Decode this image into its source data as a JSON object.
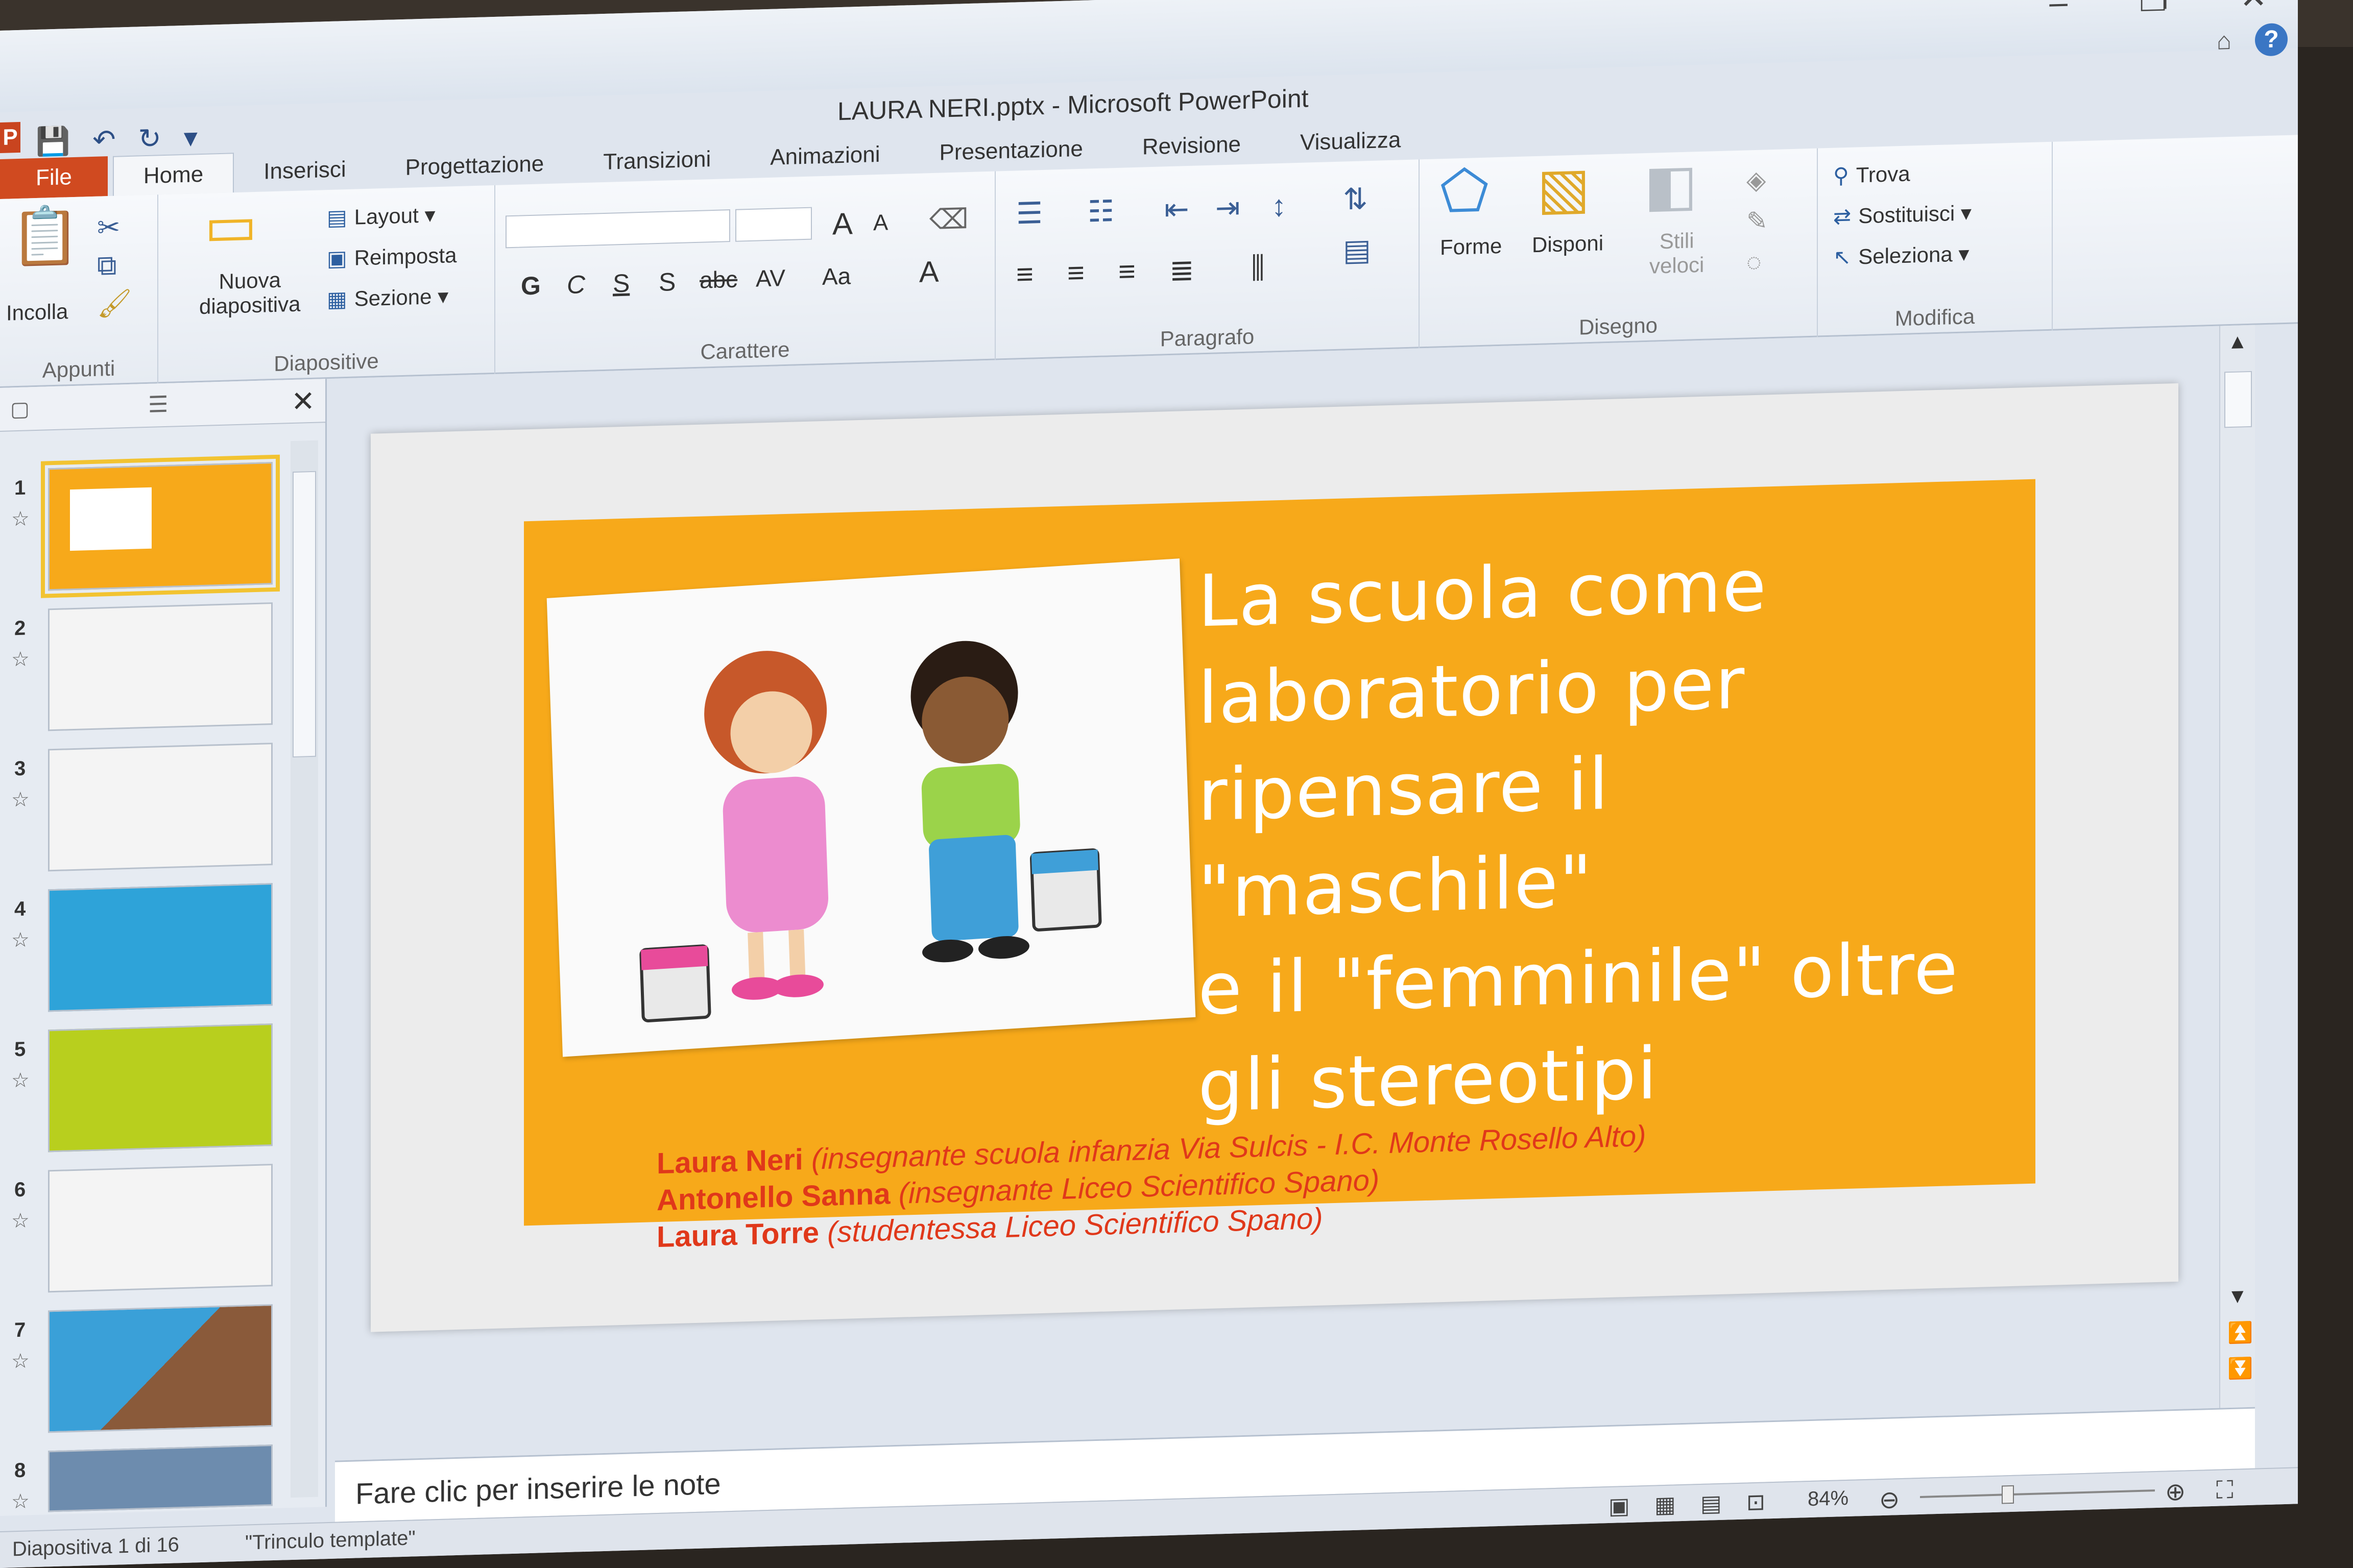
{
  "window": {
    "title": "LAURA NERI.pptx - Microsoft PowerPoint"
  },
  "qat": {
    "save": "💾",
    "undo": "↶",
    "redo": "↻",
    "more": "▾"
  },
  "tabs": [
    "File",
    "Home",
    "Inserisci",
    "Progettazione",
    "Transizioni",
    "Animazioni",
    "Presentazione",
    "Revisione",
    "Visualizza"
  ],
  "ribbon": {
    "appunti": {
      "label": "Appunti",
      "paste": "Incolla"
    },
    "diapositive": {
      "label": "Diapositive",
      "new_slide_1": "Nuova",
      "new_slide_2": "diapositiva",
      "layout": "Layout",
      "reset": "Reimposta",
      "section": "Sezione"
    },
    "carattere": {
      "label": "Carattere",
      "bold": "G",
      "italic": "C",
      "underline": "S",
      "shadow": "S",
      "strike": "abc",
      "spacing": "AV",
      "case": "Aa",
      "grow": "A",
      "shrink": "A"
    },
    "paragrafo": {
      "label": "Paragrafo"
    },
    "disegno": {
      "label": "Disegno",
      "shapes": "Forme",
      "arrange": "Disponi",
      "styles_1": "Stili",
      "styles_2": "veloci"
    },
    "modifica": {
      "label": "Modifica",
      "find": "Trova",
      "replace": "Sostituisci",
      "select": "Seleziona"
    }
  },
  "thumbnails": [
    {
      "num": "1"
    },
    {
      "num": "2"
    },
    {
      "num": "3"
    },
    {
      "num": "4"
    },
    {
      "num": "5"
    },
    {
      "num": "6"
    },
    {
      "num": "7"
    },
    {
      "num": "8"
    }
  ],
  "slide": {
    "title_lines": [
      "La scuola come",
      "laboratorio per",
      "ripensare il \"maschile\"",
      "e il \"femminile\" oltre",
      "gli stereotipi"
    ],
    "credits": [
      {
        "name": "Laura Neri",
        "role": "(insegnante scuola infanzia Via Sulcis - I.C. Monte Rosello Alto)"
      },
      {
        "name": "Antonello Sanna",
        "role": "(insegnante Liceo Scientifico Spano)"
      },
      {
        "name": "Laura Torre",
        "role": "(studentessa Liceo Scientifico Spano)"
      }
    ]
  },
  "notes": {
    "placeholder": "Fare clic per inserire le note"
  },
  "status": {
    "slide_info": "Diapositiva 1 di 16",
    "theme": "\"Trinculo template\"",
    "zoom": "84%"
  },
  "colors": {
    "banner": "#f7a91a",
    "file_tab": "#d04a20",
    "credits": "#e0381a",
    "selection": "#f2c331"
  }
}
